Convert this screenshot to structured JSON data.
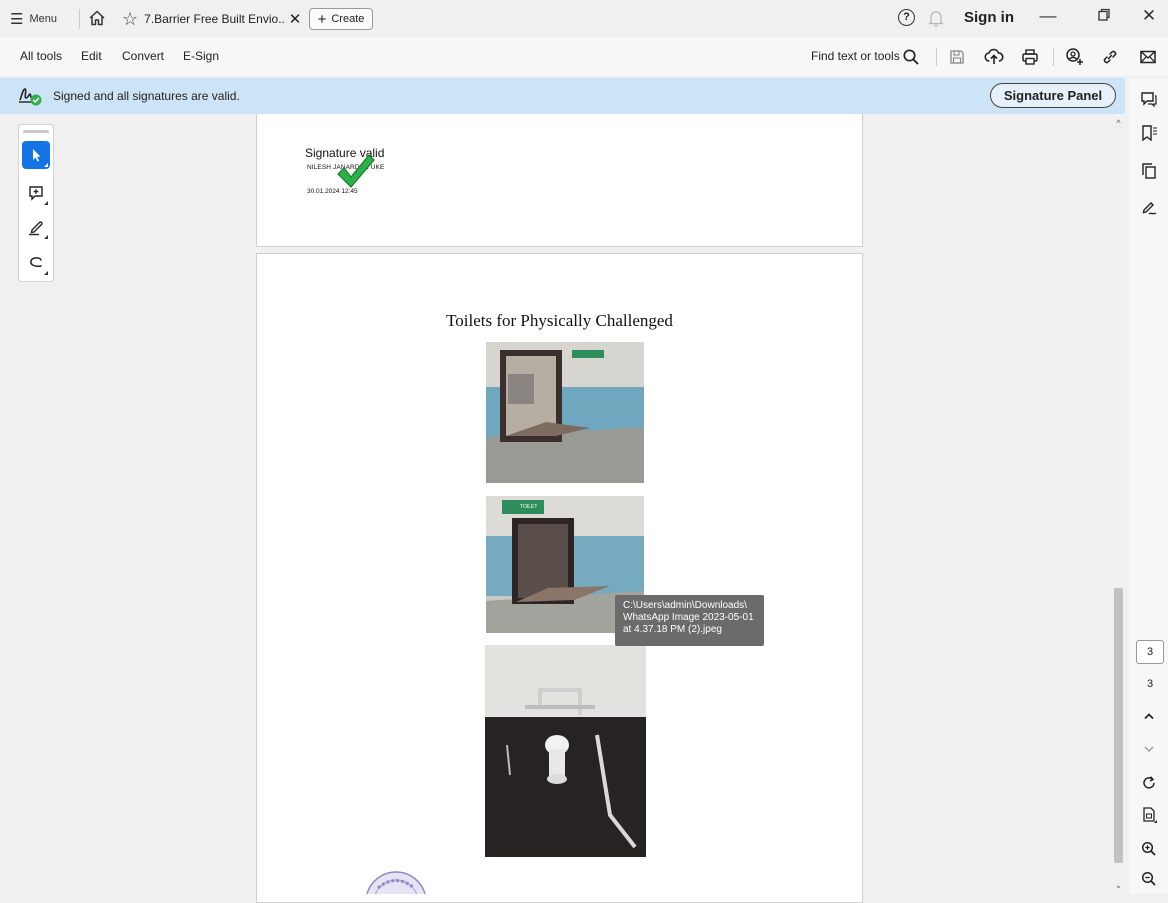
{
  "titlebar": {
    "menu_label": "Menu",
    "tab_title": "7.Barrier Free Built Envio...",
    "create_label": "Create",
    "help_glyph": "?",
    "sign_in_label": "Sign in"
  },
  "menubar": {
    "items": [
      "All tools",
      "Edit",
      "Convert",
      "E-Sign"
    ],
    "find_label": "Find text or tools"
  },
  "signature_bar": {
    "message": "Signed and all signatures are valid.",
    "panel_button": "Signature Panel"
  },
  "page1": {
    "sig_title": "Signature valid",
    "sig_name": "NILESH JANARDAN UKE",
    "sig_date": "30.01.2024 12:45"
  },
  "page2": {
    "heading": "Toilets for Physically Challenged",
    "sign_text": "TOILET"
  },
  "tooltip": {
    "line1": "C:\\Users\\admin\\Downloads\\",
    "line2": "WhatsApp Image 2023-05-01",
    "line3": "at 4.37.18 PM (2).jpeg"
  },
  "page_nav": {
    "current": "3",
    "total": "3"
  },
  "colors": {
    "accent": "#1473e6",
    "sigbar": "#cde4f7",
    "check_green": "#2db24a"
  },
  "icons": [
    "menu-icon",
    "home-icon",
    "star-icon",
    "close-icon",
    "plus-icon",
    "help-icon",
    "bell-icon",
    "minimize-icon",
    "maximize-icon",
    "search-icon",
    "save-icon",
    "upload-icon",
    "print-icon",
    "share-icon",
    "link-icon",
    "email-icon",
    "signature-status-icon",
    "select-cursor-icon",
    "comment-add-icon",
    "highlight-pen-icon",
    "draw-icon",
    "comments-icon",
    "bookmark-icon",
    "pages-icon",
    "fill-sign-icon",
    "refresh-icon",
    "page-fit-icon",
    "zoom-in-icon",
    "zoom-out-icon"
  ]
}
